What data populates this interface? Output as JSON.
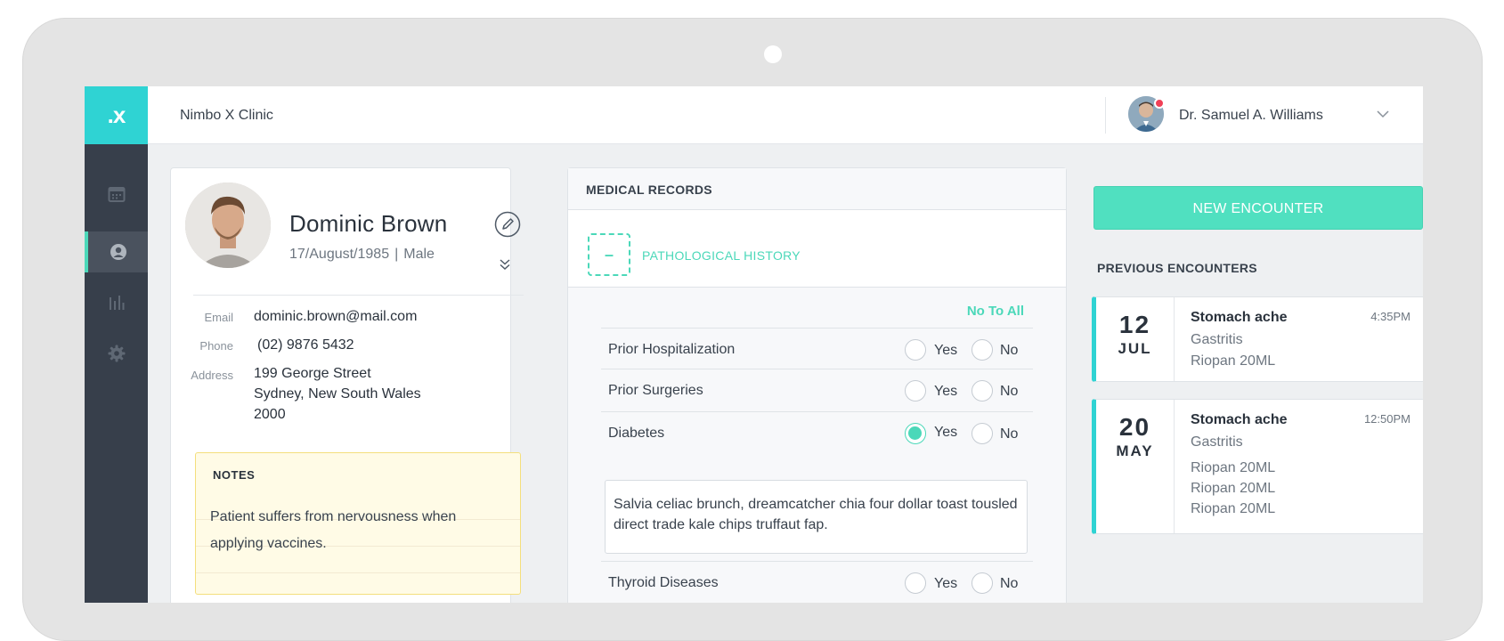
{
  "app": {
    "logo": ".x",
    "clinic_name": "Nimbo X Clinic",
    "user_name": "Dr. Samuel A. Williams"
  },
  "sidebar": {
    "items": [
      {
        "icon": "calendar-icon",
        "active": false
      },
      {
        "icon": "user-icon",
        "active": true
      },
      {
        "icon": "bar-chart-icon",
        "active": false
      },
      {
        "icon": "gear-icon",
        "active": false
      }
    ]
  },
  "patient": {
    "name": "Dominic Brown",
    "dob": "17/August/1985",
    "gender": "Male",
    "email_label": "Email",
    "email": "dominic.brown@mail.com",
    "phone_label": "Phone",
    "phone": "(02) 9876 5432",
    "address_label": "Address",
    "address_line1": "199 George Street",
    "address_line2": "Sydney, New South Wales",
    "address_line3": "2000",
    "notes_title": "NOTES",
    "notes_line1": "Patient suffers from nervousness when",
    "notes_line2": "applying vaccines."
  },
  "records": {
    "title": "MEDICAL RECORDS",
    "section_title": "PATHOLOGICAL HISTORY",
    "collapse_symbol": "–",
    "no_to_all": "No To All",
    "yes_label": "Yes",
    "no_label": "No",
    "questions": [
      {
        "label": "Prior Hospitalization",
        "answer": ""
      },
      {
        "label": "Prior Surgeries",
        "answer": ""
      },
      {
        "label": "Diabetes",
        "answer": "Yes"
      },
      {
        "label": "Thyroid Diseases",
        "answer": ""
      }
    ],
    "diabetes_note": "Salvia celiac brunch, dreamcatcher chia four dollar toast tousled direct trade kale chips truffaut fap."
  },
  "encounters": {
    "new_button": "NEW ENCOUNTER",
    "previous_title": "PREVIOUS ENCOUNTERS",
    "items": [
      {
        "day": "12",
        "month": "JUL",
        "title": "Stomach ache",
        "time": "4:35PM",
        "lines": [
          "Gastritis",
          "Riopan 20ML"
        ]
      },
      {
        "day": "20",
        "month": "MAY",
        "title": "Stomach ache",
        "time": "12:50PM",
        "lines": [
          "Gastritis",
          "Riopan 20ML",
          "Riopan 20ML",
          "Riopan 20ML"
        ]
      }
    ]
  },
  "colors": {
    "accent": "#4bd8b9",
    "logo_bg": "#2fd3d3",
    "sidebar_bg": "#373f4b",
    "notification": "#f04057"
  }
}
